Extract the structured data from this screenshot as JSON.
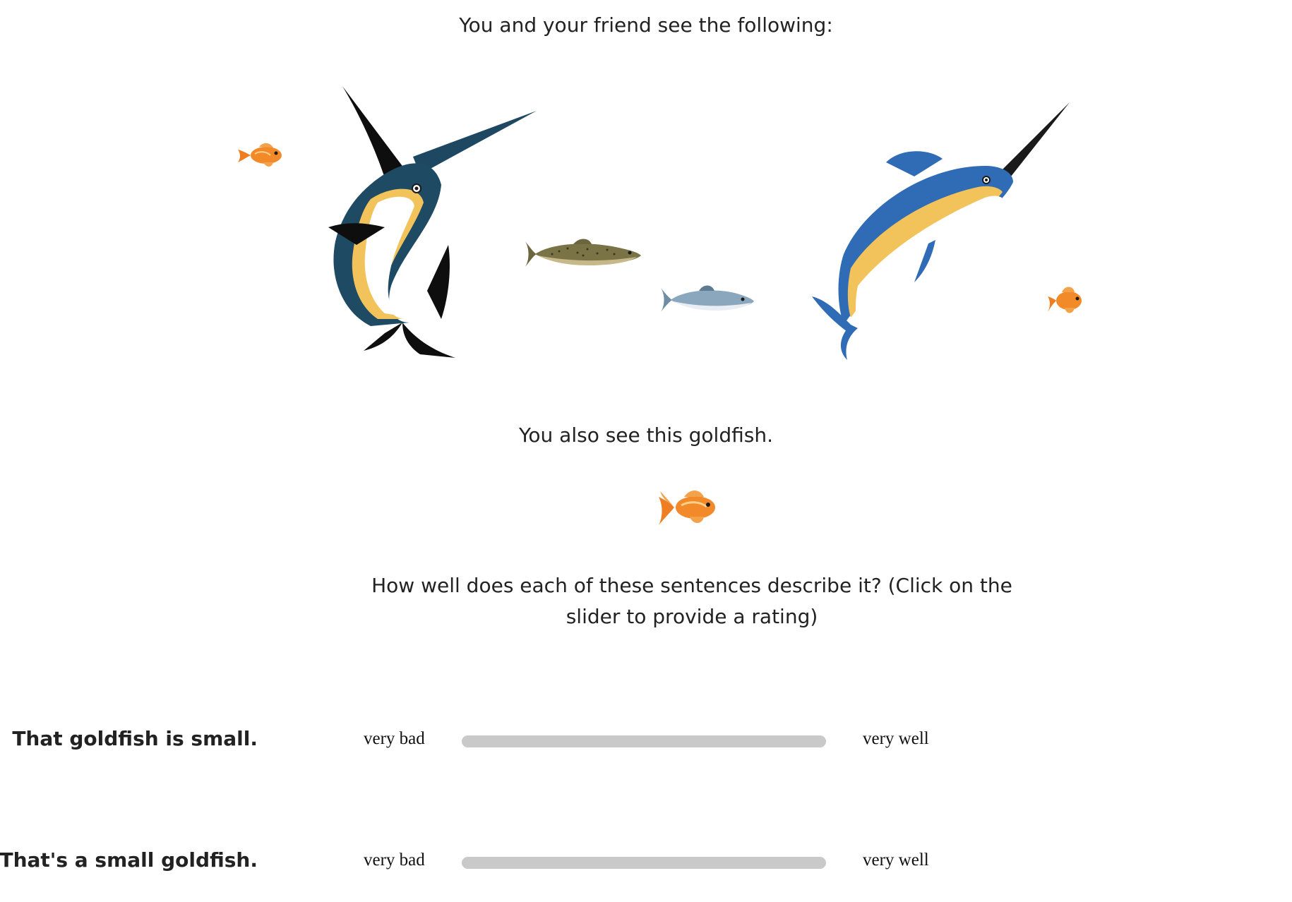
{
  "intro_text": "You and your friend see the following:",
  "context_images": [
    {
      "name": "goldfish-small-left",
      "kind": "goldfish"
    },
    {
      "name": "marlin-dark-left",
      "kind": "marlin"
    },
    {
      "name": "trout",
      "kind": "trout"
    },
    {
      "name": "salmon",
      "kind": "salmon"
    },
    {
      "name": "marlin-blue-right",
      "kind": "marlin"
    },
    {
      "name": "goldfish-small-right",
      "kind": "goldfish"
    }
  ],
  "also_text": "You also see this goldfish.",
  "target_image": {
    "name": "target-goldfish",
    "kind": "goldfish"
  },
  "question_text": "How well does each of these sentences describe it? (Click on the slider to provide a rating)",
  "ratings": [
    {
      "sentence": "That goldfish is small.",
      "left_label": "very bad",
      "right_label": "very well"
    },
    {
      "sentence": "That's a small goldfish.",
      "left_label": "very bad",
      "right_label": "very well"
    }
  ],
  "colors": {
    "text": "#222222",
    "slider_track": "#c9c9c9",
    "goldfish": "#f07a1c",
    "marlin_dark": "#1f4a63",
    "marlin_blue": "#2f6cb5",
    "marlin_yellow": "#f2c35a",
    "trout": "#7a7346",
    "salmon": "#8aa7bd"
  }
}
